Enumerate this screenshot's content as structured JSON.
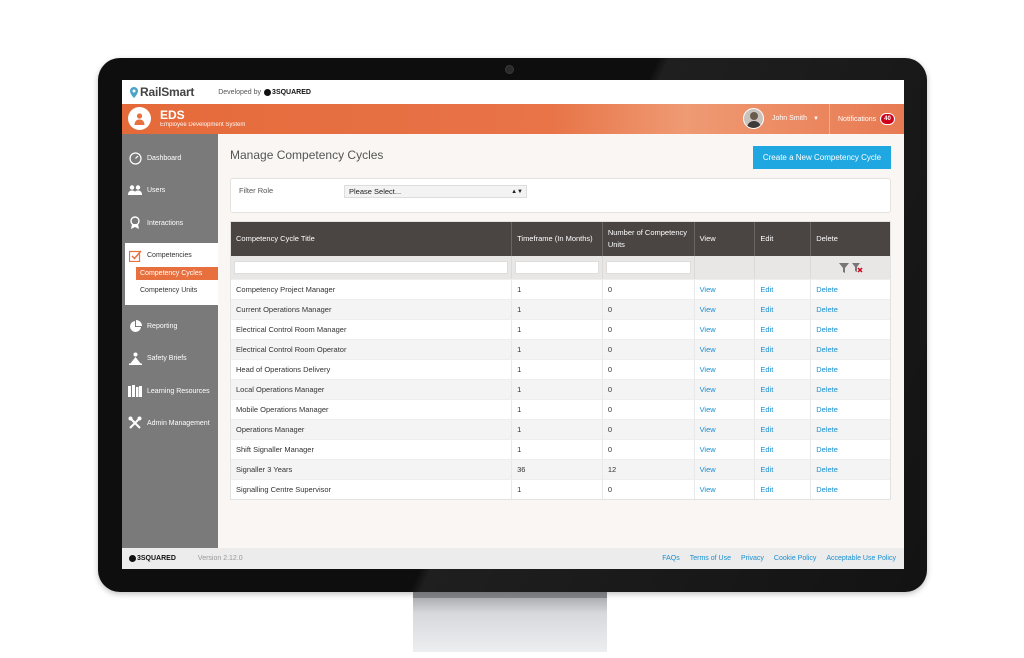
{
  "brand": {
    "product": "RailSmart",
    "developed_by": "Developed by",
    "company": "3SQUARED"
  },
  "header": {
    "app_short": "EDS",
    "app_full": "Employee Development System",
    "user_name": "John Smith",
    "notifications_label": "Notifications",
    "notifications_count": "40"
  },
  "sidebar": {
    "items": [
      {
        "label": "Dashboard",
        "icon": "dashboard-icon"
      },
      {
        "label": "Users",
        "icon": "users-icon"
      },
      {
        "label": "Interactions",
        "icon": "award-icon"
      },
      {
        "label": "Competencies",
        "icon": "competencies-icon"
      },
      {
        "label": "Reporting",
        "icon": "pie-chart-icon"
      },
      {
        "label": "Safety Briefs",
        "icon": "safety-icon"
      },
      {
        "label": "Learning Resources",
        "icon": "library-icon"
      },
      {
        "label": "Admin Management",
        "icon": "tools-icon"
      }
    ],
    "sub_items": [
      "Competency Cycles",
      "Competency Units"
    ]
  },
  "main": {
    "page_title": "Manage Competency Cycles",
    "create_button": "Create a New Competency Cycle",
    "filter_label": "Filter Role",
    "filter_value": "Please Select..."
  },
  "table": {
    "headers": [
      "Competency Cycle Title",
      "Timeframe (In Months)",
      "Number of Competency Units",
      "View",
      "Edit",
      "Delete"
    ],
    "rows": [
      [
        "Competency Project Manager",
        "1",
        "0",
        "View",
        "Edit",
        "Delete"
      ],
      [
        "Current Operations Manager",
        "1",
        "0",
        "View",
        "Edit",
        "Delete"
      ],
      [
        "Electrical Control Room Manager",
        "1",
        "0",
        "View",
        "Edit",
        "Delete"
      ],
      [
        "Electrical Control Room Operator",
        "1",
        "0",
        "View",
        "Edit",
        "Delete"
      ],
      [
        "Head of Operations Delivery",
        "1",
        "0",
        "View",
        "Edit",
        "Delete"
      ],
      [
        "Local Operations Manager",
        "1",
        "0",
        "View",
        "Edit",
        "Delete"
      ],
      [
        "Mobile Operations Manager",
        "1",
        "0",
        "View",
        "Edit",
        "Delete"
      ],
      [
        "Operations Manager",
        "1",
        "0",
        "View",
        "Edit",
        "Delete"
      ],
      [
        "Shift Signaller Manager",
        "1",
        "0",
        "View",
        "Edit",
        "Delete"
      ],
      [
        "Signaller 3 Years",
        "36",
        "12",
        "View",
        "Edit",
        "Delete"
      ],
      [
        "Signalling Centre Supervisor",
        "1",
        "0",
        "View",
        "Edit",
        "Delete"
      ]
    ]
  },
  "footer": {
    "company": "3SQUARED",
    "version": "Version 2.12.0",
    "links": [
      "FAQs",
      "Terms of Use",
      "Privacy",
      "Cookie Policy",
      "Acceptable Use Policy"
    ]
  },
  "colors": {
    "accent_orange": "#e8703f",
    "button_blue": "#1ea7e1",
    "link_blue": "#1a8fd0",
    "sidebar_gray": "#7a7a7a",
    "table_header": "#4a4443"
  }
}
